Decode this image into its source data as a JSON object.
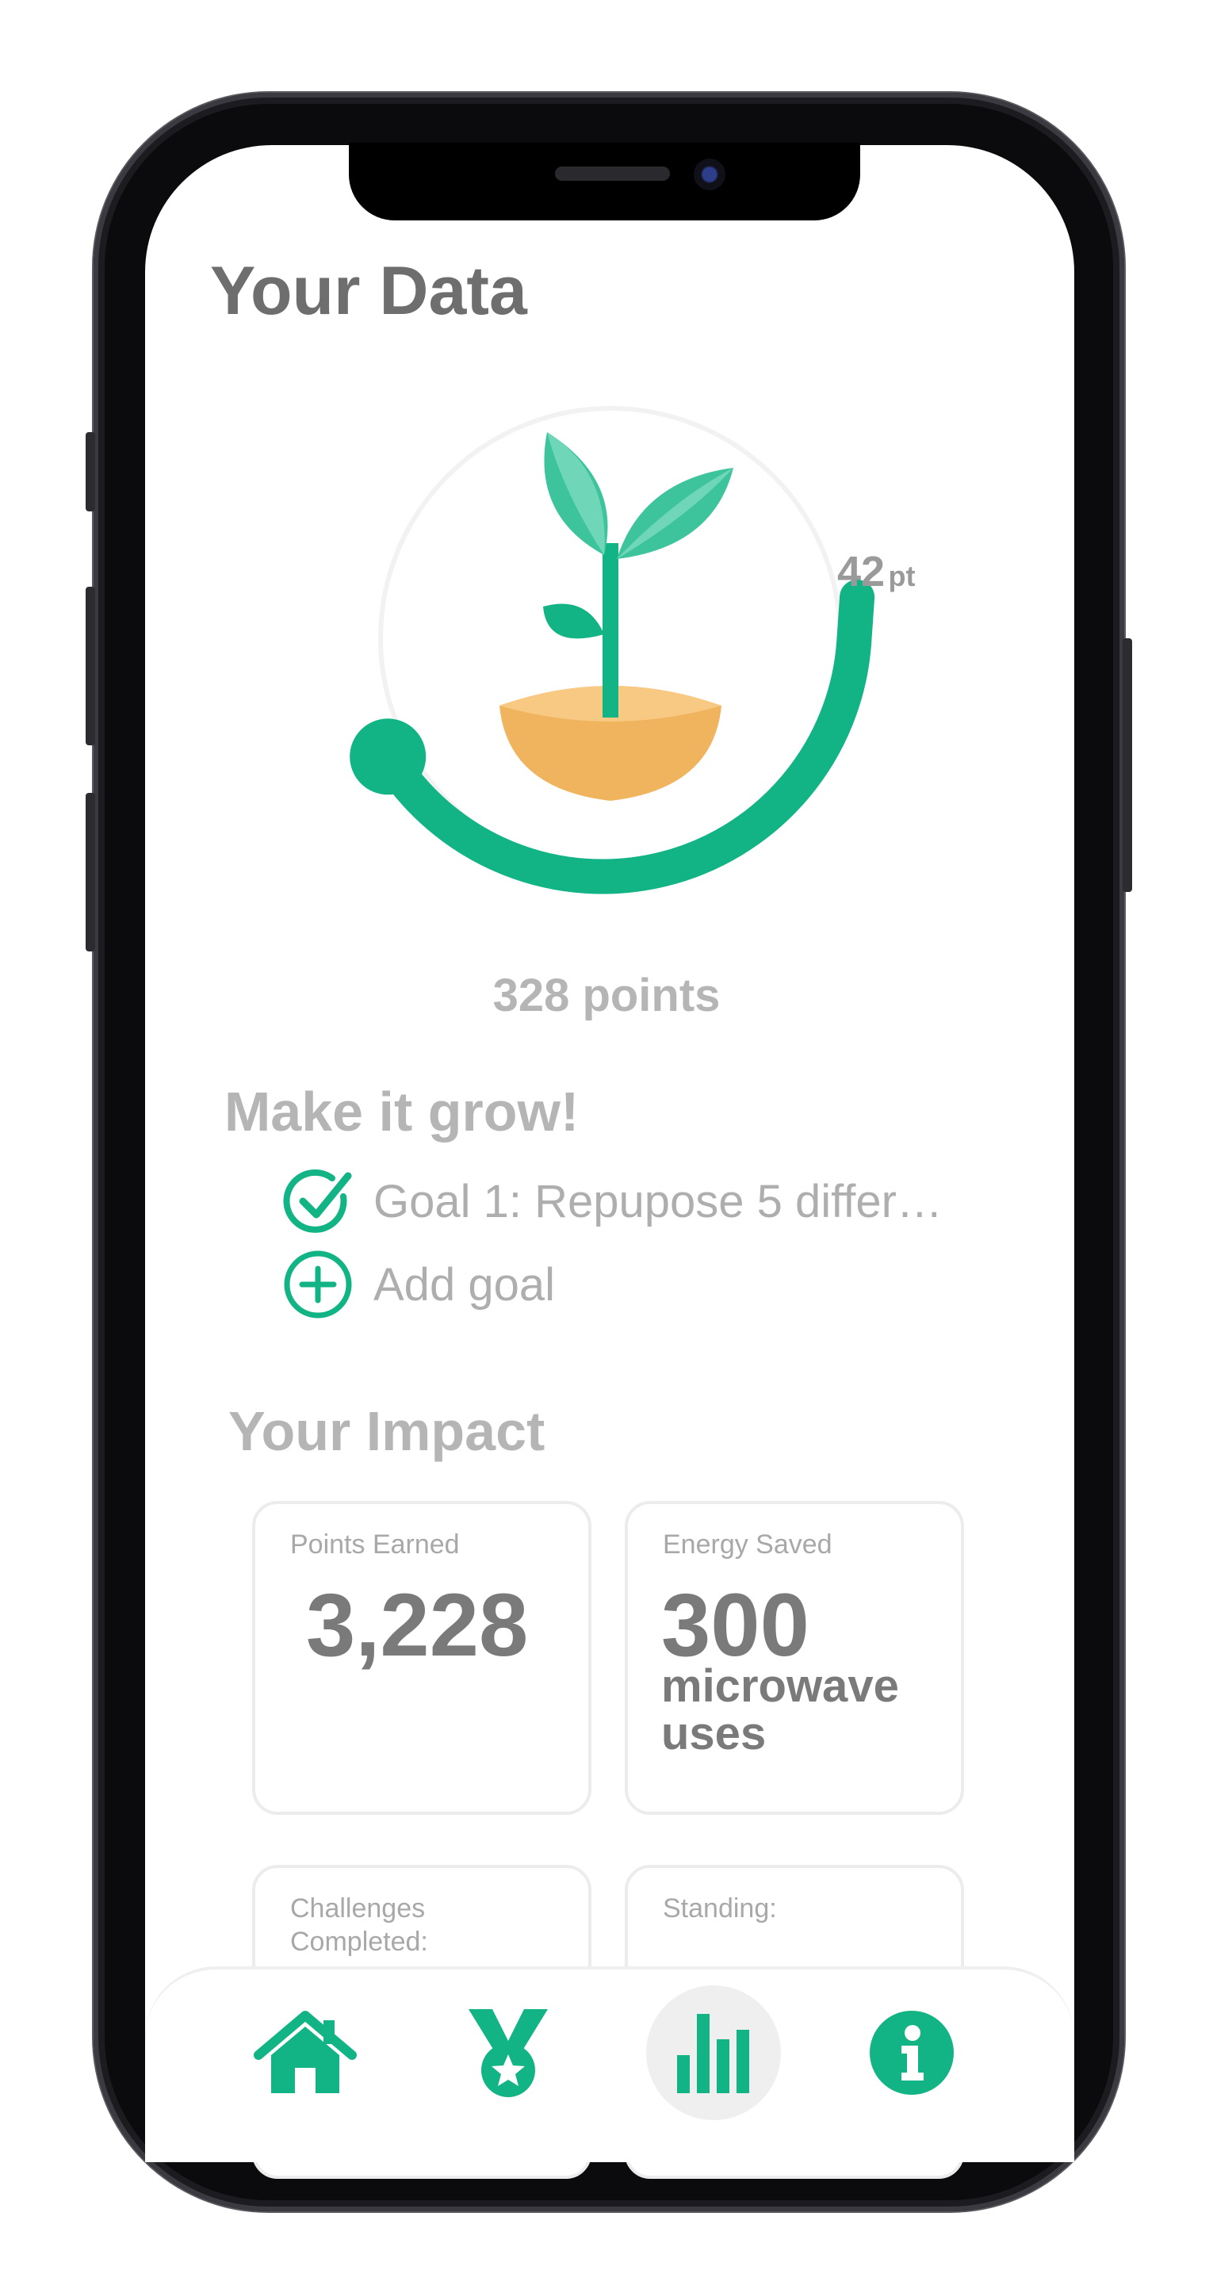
{
  "colors": {
    "accent": "#12b486",
    "accent_light": "#6fd7b8",
    "pot": "#f5c27a",
    "text_dark": "#6e6e6e",
    "text_muted": "#b5b5b5"
  },
  "page": {
    "title": "Your Data"
  },
  "progress": {
    "badge_value": "42",
    "badge_unit": "pt",
    "total_points": "328 points"
  },
  "goals": {
    "heading": "Make it grow!",
    "items": [
      {
        "icon": "check-circle-icon",
        "label": "Goal 1: Repupose 5 differ…"
      },
      {
        "icon": "plus-circle-icon",
        "label": "Add goal"
      }
    ]
  },
  "impact": {
    "heading": "Your Impact",
    "cards": [
      {
        "label": "Points Earned",
        "value": "3,228",
        "unit": ""
      },
      {
        "label": "Energy Saved",
        "value": "300",
        "unit": "microwave uses"
      },
      {
        "label": "Challenges Completed:",
        "value": "",
        "unit": ""
      },
      {
        "label": "Standing:",
        "value": "",
        "unit": ""
      }
    ]
  },
  "nav": {
    "items": [
      {
        "icon": "home-icon",
        "active": false
      },
      {
        "icon": "medal-icon",
        "active": false
      },
      {
        "icon": "bar-chart-icon",
        "active": true
      },
      {
        "icon": "info-icon",
        "active": false
      }
    ]
  }
}
